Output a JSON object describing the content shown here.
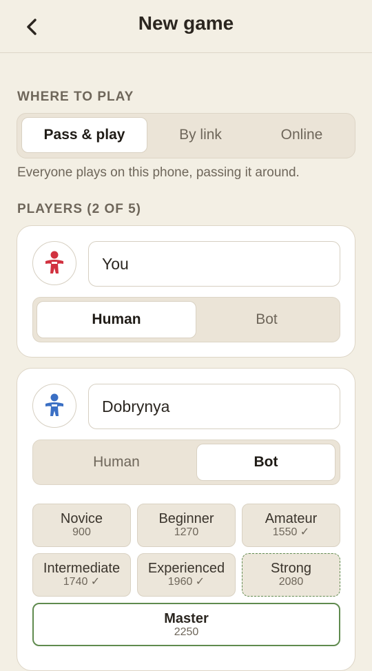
{
  "header": {
    "title": "New game",
    "back_icon": "chevron-left-icon"
  },
  "where": {
    "label": "WHERE TO PLAY",
    "options": [
      {
        "label": "Pass & play",
        "active": true
      },
      {
        "label": "By link",
        "active": false
      },
      {
        "label": "Online",
        "active": false
      }
    ],
    "hint": "Everyone plays on this phone, passing it around."
  },
  "players": {
    "label": "PLAYERS (2 OF 5)",
    "list": [
      {
        "name": "You",
        "avatar_icon": "person-icon",
        "avatar_color": "#d1313f",
        "type_options": [
          {
            "label": "Human",
            "active": true
          },
          {
            "label": "Bot",
            "active": false
          }
        ]
      },
      {
        "name": "Dobrynya",
        "avatar_icon": "person-icon",
        "avatar_color": "#3a6fc4",
        "type_options": [
          {
            "label": "Human",
            "active": false
          },
          {
            "label": "Bot",
            "active": true
          }
        ],
        "levels": [
          {
            "name": "Novice",
            "elo": "900"
          },
          {
            "name": "Beginner",
            "elo": "1270"
          },
          {
            "name": "Amateur",
            "elo": "1550 ✓"
          },
          {
            "name": "Intermediate",
            "elo": "1740 ✓"
          },
          {
            "name": "Experienced",
            "elo": "1960 ✓"
          },
          {
            "name": "Strong",
            "elo": "2080"
          },
          {
            "name": "Master",
            "elo": "2250"
          }
        ]
      }
    ]
  },
  "colors": {
    "accent_green": "#5f8a4e",
    "background": "#f3efe4"
  }
}
